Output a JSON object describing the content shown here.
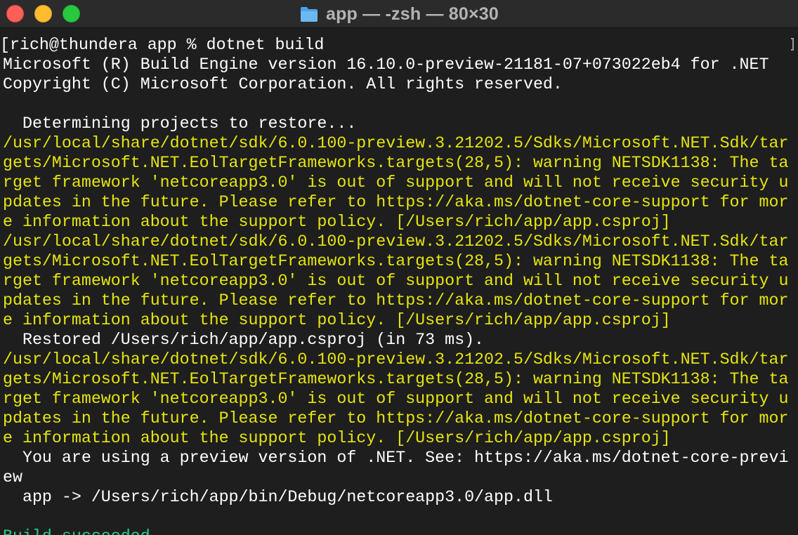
{
  "window": {
    "title": "app — -zsh — 80×30",
    "folder_icon": "folder-icon"
  },
  "colors": {
    "background": "#1e1e1e",
    "text": "#ffffff",
    "warning": "#e5e510",
    "success": "#23d18b",
    "close": "#fe5f57",
    "minimize": "#febc2e",
    "maximize": "#28c840"
  },
  "terminal": {
    "lines": [
      {
        "text": "[rich@thundera app % dotnet build",
        "kind": "prompt"
      },
      {
        "text": "Microsoft (R) Build Engine version 16.10.0-preview-21181-07+073022eb4 for .NET",
        "kind": "normal"
      },
      {
        "text": "Copyright (C) Microsoft Corporation. All rights reserved.",
        "kind": "normal"
      },
      {
        "text": "",
        "kind": "normal"
      },
      {
        "text": "  Determining projects to restore...",
        "kind": "normal"
      },
      {
        "text": "/usr/local/share/dotnet/sdk/6.0.100-preview.3.21202.5/Sdks/Microsoft.NET.Sdk/tar",
        "kind": "warn"
      },
      {
        "text": "gets/Microsoft.NET.EolTargetFrameworks.targets(28,5): warning NETSDK1138: The ta",
        "kind": "warn"
      },
      {
        "text": "rget framework 'netcoreapp3.0' is out of support and will not receive security u",
        "kind": "warn"
      },
      {
        "text": "pdates in the future. Please refer to https://aka.ms/dotnet-core-support for mor",
        "kind": "warn"
      },
      {
        "text": "e information about the support policy. [/Users/rich/app/app.csproj]",
        "kind": "warn"
      },
      {
        "text": "/usr/local/share/dotnet/sdk/6.0.100-preview.3.21202.5/Sdks/Microsoft.NET.Sdk/tar",
        "kind": "warn"
      },
      {
        "text": "gets/Microsoft.NET.EolTargetFrameworks.targets(28,5): warning NETSDK1138: The ta",
        "kind": "warn"
      },
      {
        "text": "rget framework 'netcoreapp3.0' is out of support and will not receive security u",
        "kind": "warn"
      },
      {
        "text": "pdates in the future. Please refer to https://aka.ms/dotnet-core-support for mor",
        "kind": "warn"
      },
      {
        "text": "e information about the support policy. [/Users/rich/app/app.csproj]",
        "kind": "warn"
      },
      {
        "text": "  Restored /Users/rich/app/app.csproj (in 73 ms).",
        "kind": "normal"
      },
      {
        "text": "/usr/local/share/dotnet/sdk/6.0.100-preview.3.21202.5/Sdks/Microsoft.NET.Sdk/tar",
        "kind": "warn"
      },
      {
        "text": "gets/Microsoft.NET.EolTargetFrameworks.targets(28,5): warning NETSDK1138: The ta",
        "kind": "warn"
      },
      {
        "text": "rget framework 'netcoreapp3.0' is out of support and will not receive security u",
        "kind": "warn"
      },
      {
        "text": "pdates in the future. Please refer to https://aka.ms/dotnet-core-support for mor",
        "kind": "warn"
      },
      {
        "text": "e information about the support policy. [/Users/rich/app/app.csproj]",
        "kind": "warn"
      },
      {
        "text": "  You are using a preview version of .NET. See: https://aka.ms/dotnet-core-previ",
        "kind": "normal"
      },
      {
        "text": "ew",
        "kind": "normal"
      },
      {
        "text": "  app -> /Users/rich/app/bin/Debug/netcoreapp3.0/app.dll",
        "kind": "normal"
      },
      {
        "text": "",
        "kind": "normal"
      },
      {
        "text": "Build succeeded.",
        "kind": "ok"
      }
    ]
  }
}
